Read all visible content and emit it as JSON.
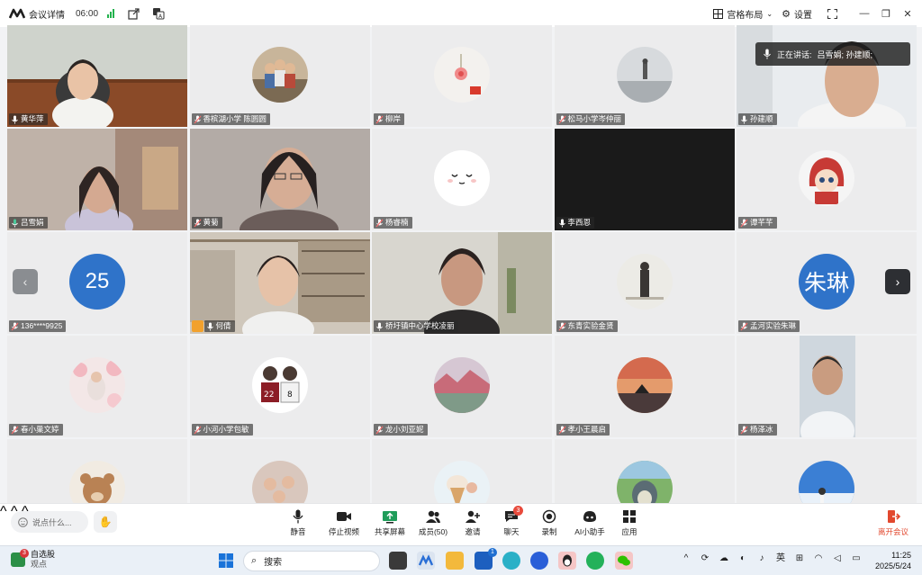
{
  "titlebar": {
    "title": "会议详情",
    "time": "06:00",
    "layout_label": "宫格布局",
    "settings_label": "设置"
  },
  "speaking": {
    "label": "正在讲话:",
    "names": "吕雪娟; 孙建顺;"
  },
  "tiles": [
    {
      "name": "黄华萍",
      "mic": "on"
    },
    {
      "name": "香槟湖小学 陈圆圆",
      "mic": "muted"
    },
    {
      "name": "柳岸",
      "mic": "muted"
    },
    {
      "name": "松马小学岑仲丽",
      "mic": "muted"
    },
    {
      "name": "孙建顺",
      "mic": "on"
    },
    {
      "name": "吕雪娟",
      "mic": "speaking"
    },
    {
      "name": "黄菊",
      "mic": "muted"
    },
    {
      "name": "杨睿楠",
      "mic": "muted"
    },
    {
      "name": "李西恩",
      "mic": "on"
    },
    {
      "name": "谭芊芊",
      "mic": "muted"
    },
    {
      "name": "136****9925",
      "mic": "muted",
      "avatar_text": "25"
    },
    {
      "name": "何倩",
      "mic": "on",
      "host": true
    },
    {
      "name": "桥圩镇中心学校凌丽",
      "mic": "on"
    },
    {
      "name": "东青实验金贤",
      "mic": "muted"
    },
    {
      "name": "孟河实验朱琳",
      "mic": "muted",
      "avatar_text": "朱琳"
    },
    {
      "name": "春小巢文婷",
      "mic": "muted"
    },
    {
      "name": "小河小学包敏",
      "mic": "muted"
    },
    {
      "name": "龙小刘亚妮",
      "mic": "muted"
    },
    {
      "name": "孝小王晨启",
      "mic": "muted"
    },
    {
      "name": "杨泽冰",
      "mic": "muted"
    }
  ],
  "toolbar": {
    "chat_placeholder": "说点什么...",
    "mute": "静音",
    "stop_video": "停止视频",
    "share_screen": "共享屏幕",
    "members": "成员(50)",
    "invite": "邀请",
    "chat": "聊天",
    "chat_badge": "3",
    "record": "录制",
    "ai_assistant": "AI小助手",
    "apps": "应用",
    "leave": "离开会议"
  },
  "taskbar": {
    "widget_title": "自选股",
    "widget_sub": "观点",
    "widget_badge": "3",
    "search_placeholder": "搜索",
    "store_badge": "1",
    "ime": "英",
    "time": "11:25",
    "date": "2025/5/24"
  },
  "colors": {
    "accent_green": "#4cc79a",
    "avatar_blue": "#2f73c9",
    "leave_red": "#e2482e"
  }
}
